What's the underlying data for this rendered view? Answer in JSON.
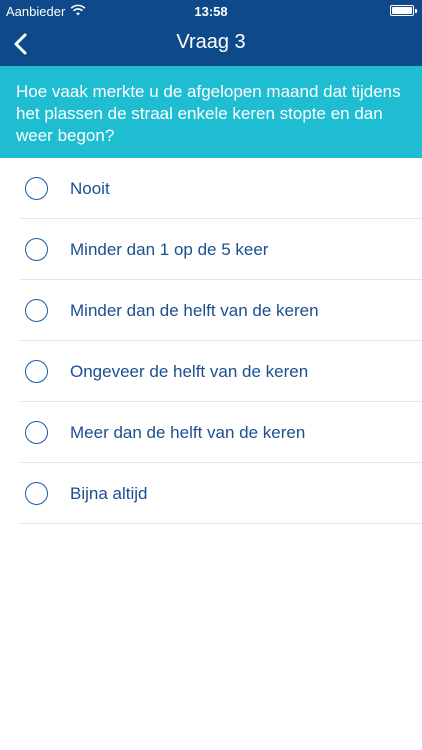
{
  "status_bar": {
    "carrier": "Aanbieder",
    "time": "13:58",
    "wifi_icon": "wifi-icon",
    "battery_icon": "battery-icon"
  },
  "nav": {
    "title": "Vraag 3",
    "back_icon": "chevron-left-icon"
  },
  "question": {
    "text": "Hoe vaak merkte u de afgelopen maand dat tijdens het plassen de straal enkele keren stopte en dan weer begon?"
  },
  "options": [
    {
      "label": "Nooit"
    },
    {
      "label": "Minder dan 1 op de 5 keer"
    },
    {
      "label": "Minder dan de helft van de keren"
    },
    {
      "label": "Ongeveer de helft van de keren"
    },
    {
      "label": "Meer dan de helft van de keren"
    },
    {
      "label": "Bijna altijd"
    }
  ],
  "colors": {
    "navbar": "#0e4a8a",
    "question_bg": "#1ebdd2",
    "option_text": "#1b4f8f",
    "radio_border": "#1b5aa0"
  }
}
